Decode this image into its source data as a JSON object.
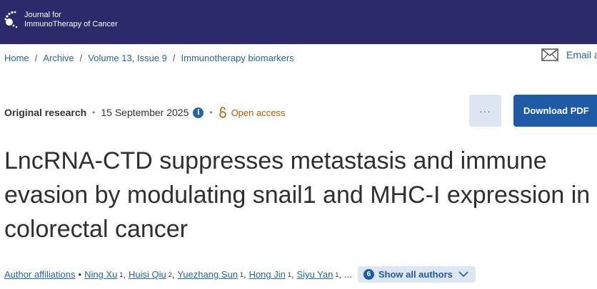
{
  "header": {
    "logo_line1": "Journal for",
    "logo_line2": "ImmunoTherapy of Cancer",
    "bg_color": "#2b2a6b"
  },
  "breadcrumb": [
    "Home",
    "Archive",
    "Volume 13, Issue 9",
    "Immunotherapy biomarkers"
  ],
  "email_label": "Email a",
  "article_meta": {
    "type": "Original research",
    "date": "15 September 2025",
    "info_icon": "i",
    "access": "Open access"
  },
  "actions": {
    "more_label": "···",
    "download_label": "Download PDF"
  },
  "title": "LncRNA-CTD suppresses metastasis and immune evasion by modulating snail1 and MHC-I expression in colorectal cancer",
  "authors": {
    "affiliations_label": "Author affiliations",
    "list": [
      {
        "name": "Ning Xu",
        "sup": "1"
      },
      {
        "name": "Huisi Qiu",
        "sup": "2"
      },
      {
        "name": "Yuezhang Sun",
        "sup": "1"
      },
      {
        "name": "Hong Jin",
        "sup": "1"
      },
      {
        "name": "Siyu Yan",
        "sup": "1"
      }
    ],
    "ellipsis": "...",
    "count": "6",
    "show_all_label": "Show all authors"
  },
  "colors": {
    "link": "#2563a8",
    "primary_button": "#1f5aa6",
    "secondary_button": "#dde6f3",
    "open_access": "#b35a00"
  },
  "icons": [
    "journal-logo-icon",
    "mail-icon",
    "info-icon",
    "open-access-lock-icon",
    "chevron-down-icon"
  ]
}
